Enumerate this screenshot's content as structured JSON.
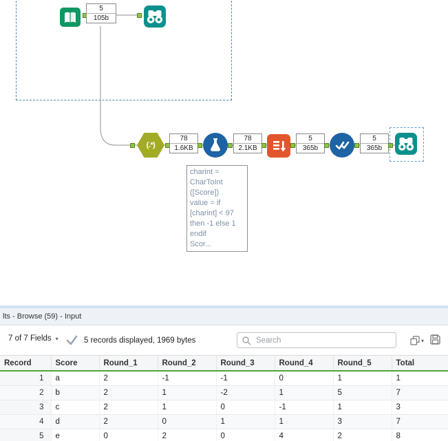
{
  "canvas": {
    "hexagon_label": "(.*)",
    "annotations": [
      {
        "count": "5",
        "size": "105b"
      },
      {
        "count": "78",
        "size": "1.6KB"
      },
      {
        "count": "78",
        "size": "2.1KB"
      },
      {
        "count": "5",
        "size": "365b"
      },
      {
        "count": "5",
        "size": "365b"
      }
    ],
    "tooltip_lines": [
      "charint =",
      "CharToInt",
      "([Score])",
      "value = if",
      "[charint] < 97",
      "then -1 else 1",
      "endif",
      "Scor..."
    ]
  },
  "results_panel": {
    "title": "lts - Browse (59) - Input",
    "toolbar": {
      "fields_label": "7 of 7 Fields",
      "records_label": "5 records displayed, 1969 bytes",
      "search_placeholder": "Search"
    },
    "table": {
      "columns": [
        "Record",
        "Score",
        "Round_1",
        "Round_2",
        "Round_3",
        "Round_4",
        "Round_5",
        "Total"
      ],
      "rows": [
        [
          "1",
          "a",
          "2",
          "-1",
          "-1",
          "0",
          "1",
          "1"
        ],
        [
          "2",
          "b",
          "2",
          "1",
          "-2",
          "1",
          "5",
          "7"
        ],
        [
          "3",
          "c",
          "2",
          "1",
          "0",
          "-1",
          "1",
          "3"
        ],
        [
          "4",
          "d",
          "2",
          "0",
          "1",
          "1",
          "3",
          "7"
        ],
        [
          "5",
          "e",
          "0",
          "2",
          "0",
          "4",
          "2",
          "8"
        ]
      ]
    }
  },
  "colors": {
    "anchor_green": "#8dc63f",
    "browse_teal": "#0b918d",
    "tool_blue": "#1e63a4",
    "regex_olive": "#a2ab26",
    "transform_orange": "#e2552d",
    "header_underline_green": "#4fa33f"
  }
}
